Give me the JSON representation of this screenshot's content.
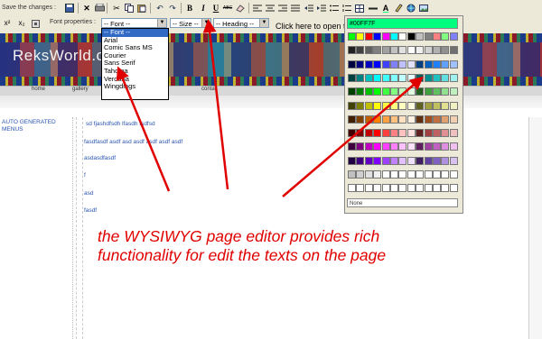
{
  "toolbar": {
    "save_label": "Save the changes :",
    "font_properties_label": "Font properties :",
    "font_select": "-- Font --",
    "size_select": "-- Size --",
    "heading_select": "-- Heading --",
    "click_here": "Click here to open t",
    "bold": "B",
    "italic": "I",
    "underline": "U",
    "strike": "ABC",
    "superscript": "x²",
    "subscript": "x₂"
  },
  "font_list": [
    "-- Font --",
    "Arial",
    "Comic Sans MS",
    "Courier",
    "Sans Serif",
    "Tahoma",
    "Verdana",
    "Wingdings"
  ],
  "site": {
    "logo": "ReksWorld.c",
    "nav": [
      "home",
      "gallery",
      "conta"
    ],
    "menu_text": "AUTO GENERATED MENUS"
  },
  "content_lines": [
    " sd fjashdfsdh lfasdh fsdfsd",
    "fasdfasdf asdf asd asdf asdf  asdf asdf",
    "asdasdfasdf",
    "f",
    "asd",
    "fasdf"
  ],
  "color_picker": {
    "hex_value": "#00FF7F",
    "none_label": "None",
    "rows": [
      [
        "#00ff00",
        "#ffff00",
        "#ff0000",
        "#0000ff",
        "#ff00ff",
        "#00ffff",
        "#ffffff",
        "#000000",
        "#c0c0c0",
        "#808080",
        "#ff8080",
        "#80ff80",
        "#8080ff"
      ],
      [
        "#202020",
        "#404040",
        "#606060",
        "#808080",
        "#a0a0a0",
        "#c0c0c0",
        "#e0e0e0",
        "#ffffff",
        "#f0f0f0",
        "#d0d0d0",
        "#b0b0b0",
        "#909090",
        "#707070"
      ],
      [
        "#000040",
        "#000080",
        "#0000c0",
        "#0000ff",
        "#4040ff",
        "#8080ff",
        "#c0c0ff",
        "#e0e0ff",
        "#004080",
        "#0060c0",
        "#2080ff",
        "#60a0ff",
        "#a0c0ff"
      ],
      [
        "#004040",
        "#008080",
        "#00c0c0",
        "#00ffff",
        "#40ffff",
        "#80ffff",
        "#c0ffff",
        "#e0ffff",
        "#006060",
        "#009090",
        "#20c0c0",
        "#60e0e0",
        "#a0f0f0"
      ],
      [
        "#004000",
        "#008000",
        "#00c000",
        "#00ff00",
        "#40ff40",
        "#80ff80",
        "#c0ffc0",
        "#e0ffe0",
        "#206020",
        "#40a040",
        "#60c060",
        "#90e090",
        "#c0f0c0"
      ],
      [
        "#404000",
        "#808000",
        "#c0c000",
        "#ffff00",
        "#ffff40",
        "#ffff80",
        "#ffffc0",
        "#ffffe0",
        "#606020",
        "#a0a040",
        "#c0c060",
        "#e0e090",
        "#f0f0c0"
      ],
      [
        "#402000",
        "#804000",
        "#c06000",
        "#ff8000",
        "#ffa040",
        "#ffc080",
        "#ffe0c0",
        "#fff0e0",
        "#603010",
        "#a05020",
        "#c07040",
        "#e0a070",
        "#f0d0b0"
      ],
      [
        "#400000",
        "#800000",
        "#c00000",
        "#ff0000",
        "#ff4040",
        "#ff8080",
        "#ffc0c0",
        "#ffe0e0",
        "#602020",
        "#a04040",
        "#c06060",
        "#e09090",
        "#f0c0c0"
      ],
      [
        "#400040",
        "#800080",
        "#c000c0",
        "#ff00ff",
        "#ff40ff",
        "#ff80ff",
        "#ffc0ff",
        "#ffe0ff",
        "#602060",
        "#a040a0",
        "#c060c0",
        "#e090e0",
        "#f0c0f0"
      ],
      [
        "#200040",
        "#400080",
        "#6000c0",
        "#8000ff",
        "#a040ff",
        "#c080ff",
        "#e0c0ff",
        "#f0e0ff",
        "#402060",
        "#6040a0",
        "#8060c0",
        "#b090e0",
        "#d8c0f0"
      ],
      [
        "#c0c0c0",
        "#d0d0d0",
        "#e0e0e0",
        "#f0f0f0",
        "#ffffff",
        "#ffffff",
        "#ffffff",
        "#ffffff",
        "#ffffff",
        "#ffffff",
        "#ffffff",
        "#ffffff",
        "#ffffff"
      ],
      [
        "#ffffff",
        "#ffffff",
        "#ffffff",
        "#ffffff",
        "#ffffff",
        "#ffffff",
        "#ffffff",
        "#ffffff",
        "#ffffff",
        "#ffffff",
        "#ffffff",
        "#ffffff",
        "#ffffff"
      ]
    ]
  },
  "annotation": {
    "line1": "the WYSIWYG page editor provides rich",
    "line2": "functionality for edit the texts on the page"
  },
  "colors": {
    "annotation": "#e00000",
    "content_text": "#2a55b0",
    "hex_swatch": "#00ff7f"
  }
}
